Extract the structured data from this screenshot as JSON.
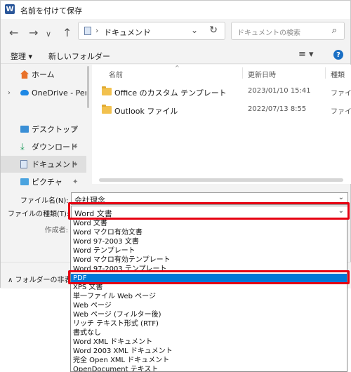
{
  "window": {
    "title": "名前を付けて保存",
    "app_icon": "W"
  },
  "nav": {
    "back": "←",
    "forward": "→",
    "recent": "∨",
    "up": "↑",
    "address_segments": [
      "ドキュメント"
    ],
    "search_placeholder": "ドキュメントの検索"
  },
  "toolbar": {
    "organize": "整理 ▾",
    "new_folder": "新しいフォルダー",
    "view": "≡ ▾",
    "help": "?"
  },
  "sidebar": {
    "items": [
      {
        "label": "ホーム",
        "icon": "home-icon"
      },
      {
        "label": "OneDrive - Perso",
        "icon": "onedrive-icon"
      },
      {
        "label": "デスクトップ",
        "icon": "desktop-icon"
      },
      {
        "label": "ダウンロード",
        "icon": "download-icon"
      },
      {
        "label": "ドキュメント",
        "icon": "documents-icon"
      },
      {
        "label": "ピクチャ",
        "icon": "pictures-icon"
      }
    ]
  },
  "filelist": {
    "columns": [
      "名前",
      "更新日時",
      "種類"
    ],
    "rows": [
      {
        "name": "Office のカスタム テンプレート",
        "date": "2023/01/10 15:41",
        "type": "ファイル"
      },
      {
        "name": "Outlook ファイル",
        "date": "2022/07/13 8:55",
        "type": "ファイル"
      }
    ]
  },
  "form": {
    "filename_label": "ファイル名(N):",
    "filename_value": "会社理念",
    "filetype_label": "ファイルの種類(T):",
    "filetype_value": "Word 文書",
    "author_label": "作成者:"
  },
  "footer": {
    "hide_folders": "∧ フォルダーの非表示"
  },
  "dropdown": {
    "options": [
      "Word 文書",
      "Word マクロ有効文書",
      "Word 97-2003 文書",
      "Word テンプレート",
      "Word マクロ有効テンプレート",
      "Word 97-2003 テンプレート",
      "PDF",
      "XPS 文書",
      "単一ファイル Web ページ",
      "Web ページ",
      "Web ページ (フィルター後)",
      "リッチ テキスト形式 (RTF)",
      "書式なし",
      "Word XML ドキュメント",
      "Word 2003 XML ドキュメント",
      "完全 Open XML ドキュメント",
      "OpenDocument テキスト"
    ],
    "selected_index": 6
  },
  "colors": {
    "accent": "#0078d7",
    "highlight": "#e60012"
  }
}
